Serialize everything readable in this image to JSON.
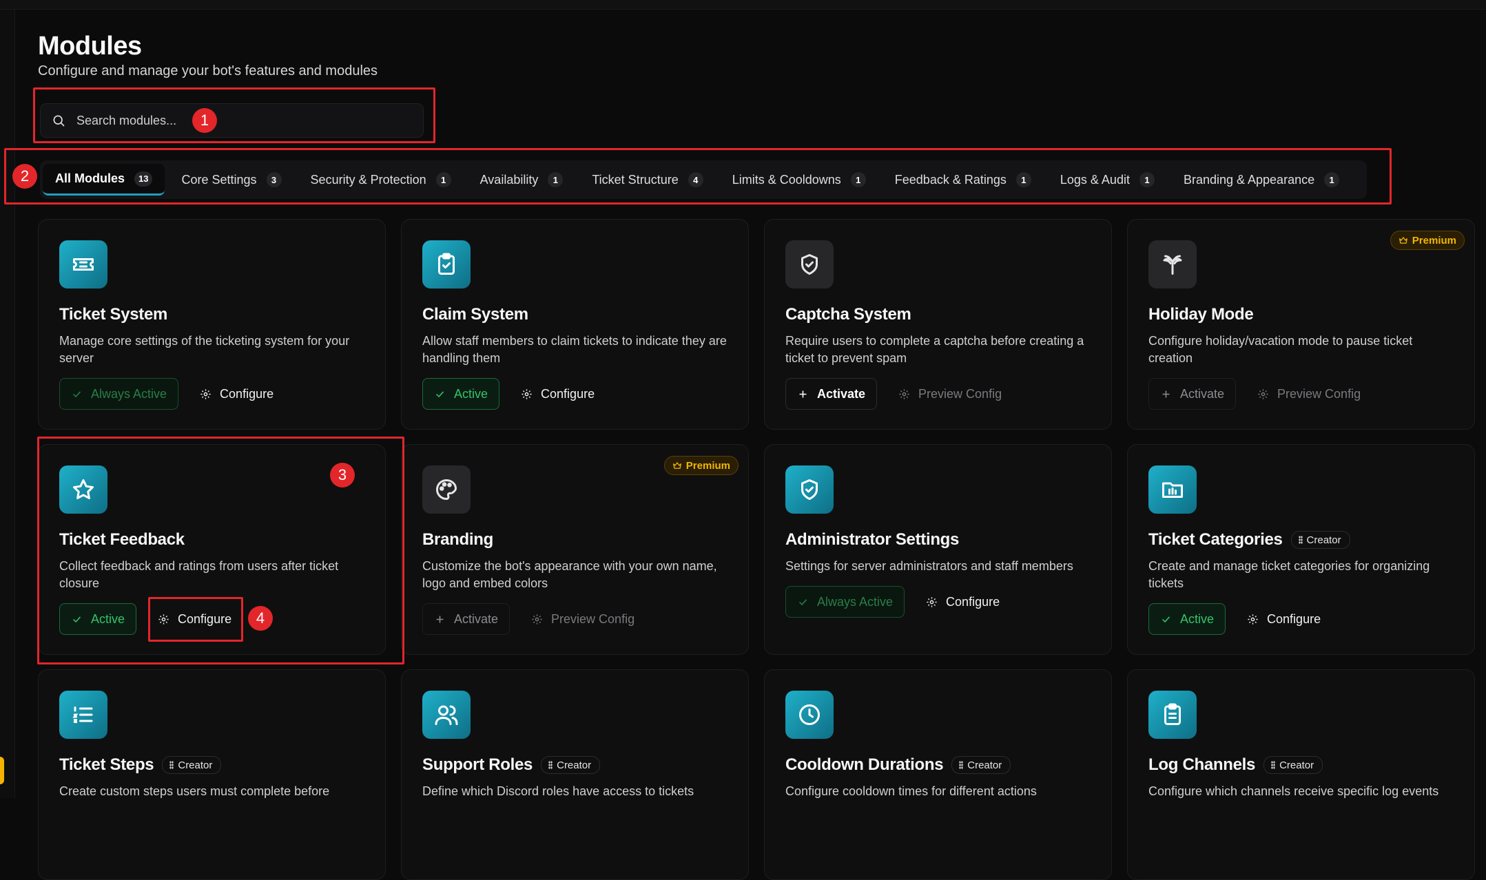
{
  "page": {
    "title": "Modules",
    "subtitle": "Configure and manage your bot's features and modules"
  },
  "search": {
    "placeholder": "Search modules...",
    "value": ""
  },
  "tabs": [
    {
      "label": "All Modules",
      "count": "13",
      "active": true
    },
    {
      "label": "Core Settings",
      "count": "3"
    },
    {
      "label": "Security & Protection",
      "count": "1"
    },
    {
      "label": "Availability",
      "count": "1"
    },
    {
      "label": "Ticket Structure",
      "count": "4"
    },
    {
      "label": "Limits & Cooldowns",
      "count": "1"
    },
    {
      "label": "Feedback & Ratings",
      "count": "1"
    },
    {
      "label": "Logs & Audit",
      "count": "1"
    },
    {
      "label": "Branding & Appearance",
      "count": "1"
    }
  ],
  "common": {
    "configure": "Configure",
    "preview_config": "Preview Config",
    "activate": "Activate",
    "active": "Active",
    "always_active": "Always Active",
    "premium": "Premium",
    "creator": "Creator"
  },
  "cards": [
    {
      "title": "Ticket System",
      "description": "Manage core settings of the ticketing system for your server",
      "icon": "ticket-icon"
    },
    {
      "title": "Claim System",
      "description": "Allow staff members to claim tickets to indicate they are handling them",
      "icon": "clipboard-check-icon"
    },
    {
      "title": "Captcha System",
      "description": "Require users to complete a captcha before creating a ticket to prevent spam",
      "icon": "shield-check-icon"
    },
    {
      "title": "Holiday Mode",
      "description": "Configure holiday/vacation mode to pause ticket creation",
      "icon": "palm-tree-icon"
    },
    {
      "title": "Ticket Feedback",
      "description": "Collect feedback and ratings from users after ticket closure",
      "icon": "star-icon"
    },
    {
      "title": "Branding",
      "description": "Customize the bot's appearance with your own name, logo and embed colors",
      "icon": "palette-icon"
    },
    {
      "title": "Administrator Settings",
      "description": "Settings for server administrators and staff members",
      "icon": "shield-check-icon"
    },
    {
      "title": "Ticket Categories",
      "description": "Create and manage ticket categories for organizing tickets",
      "icon": "folder-icon"
    },
    {
      "title": "Ticket Steps",
      "description": "Create custom steps users must complete before",
      "icon": "list-icon"
    },
    {
      "title": "Support Roles",
      "description": "Define which Discord roles have access to tickets",
      "icon": "users-icon"
    },
    {
      "title": "Cooldown Durations",
      "description": "Configure cooldown times for different actions",
      "icon": "clock-icon"
    },
    {
      "title": "Log Channels",
      "description": "Configure which channels receive specific log events",
      "icon": "clipboard-list-icon"
    }
  ],
  "annotations": [
    "1",
    "2",
    "3",
    "4"
  ],
  "colors": {
    "accent": "#1f9fc0",
    "active_green": "#34c26b",
    "premium_gold": "#f2b705",
    "annotation_red": "#e3262a"
  }
}
